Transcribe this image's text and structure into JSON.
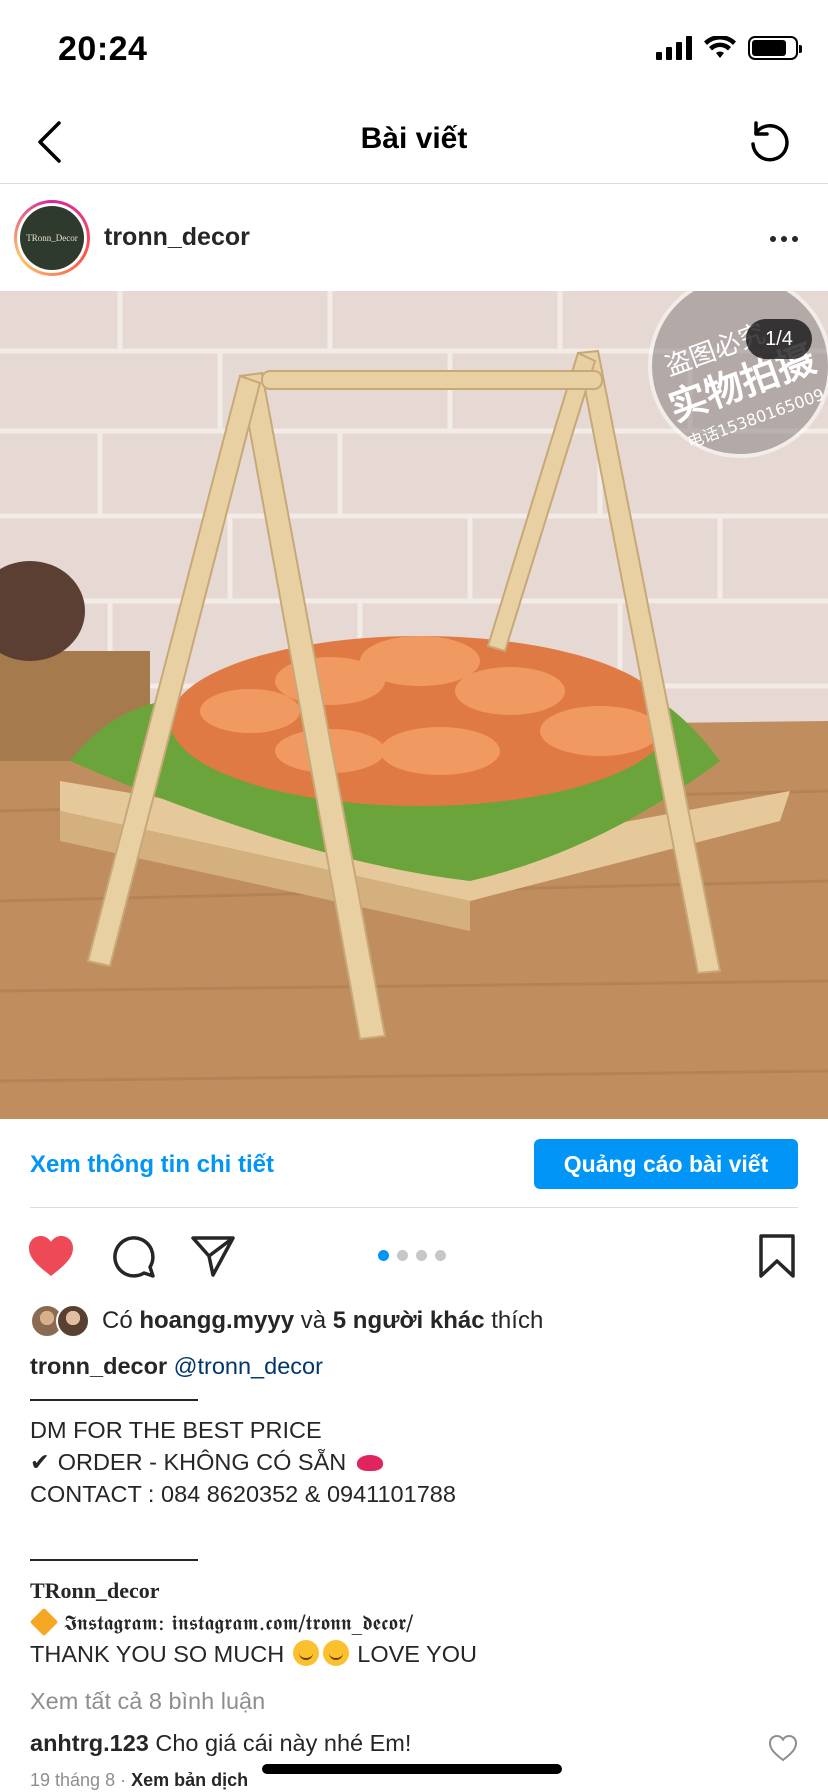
{
  "status_bar": {
    "time": "20:24"
  },
  "nav": {
    "title": "Bài viết",
    "back_icon": "chevron-left-icon",
    "refresh_icon": "refresh-icon"
  },
  "post": {
    "username": "tronn_decor",
    "avatar_text": "TRonn_Decor",
    "page_indicator": "1/4",
    "watermark_line1": "盗图必究",
    "watermark_line2": "实物拍摄",
    "watermark_phone": "电话15380165009"
  },
  "promo": {
    "details_link": "Xem thông tin chi tiết",
    "promote_button": "Quảng cáo bài viết"
  },
  "carousel": {
    "count": 4,
    "active": 0
  },
  "likes": {
    "prefix": "Có",
    "user": "hoangg.myyy",
    "and": "và",
    "others": "5 người khác",
    "suffix": "thích"
  },
  "caption": {
    "username": "tronn_decor",
    "mention": "@tronn_decor",
    "line1": "DM FOR THE BEST PRICE",
    "line2": "ORDER - KHÔNG CÓ SẴN",
    "line2_check": "✔",
    "line3": "CONTACT : 084 8620352 & 0941101788",
    "brand": "TRonn_decor",
    "instagram_line": "𝕴𝖓𝖘𝖙𝖆𝖌𝖗𝖆𝖒: 𝖎𝖓𝖘𝖙𝖆𝖌𝖗𝖆𝖒.𝖈𝖔𝖒/𝖙𝖗𝖔𝖓𝖓_𝖉𝖊𝖈𝖔𝖗/",
    "thanks_a": "THANK YOU SO MUCH",
    "thanks_b": "LOVE YOU"
  },
  "comments": {
    "view_all": "Xem tất cả 8 bình luận",
    "first_user": "anhtrg.123",
    "first_text": "Cho giá cái này nhé Em!",
    "date": "19 tháng 8",
    "translate": "Xem bản dịch"
  },
  "colors": {
    "accent": "#0095f6",
    "like": "#ed4956",
    "mention": "#00376b",
    "muted": "#8e8e8e"
  }
}
